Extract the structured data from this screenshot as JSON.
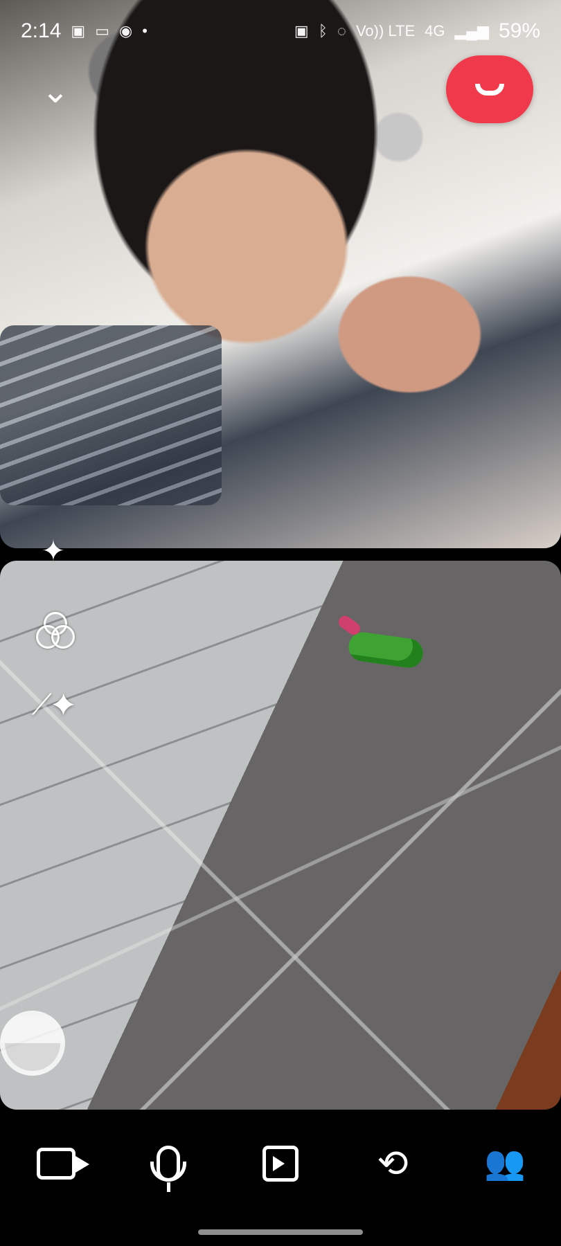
{
  "status_bar": {
    "time": "2:14",
    "left_icons": [
      "image-icon",
      "video-icon",
      "messenger-icon",
      "dot-icon"
    ],
    "right_icons": [
      "lock-icon",
      "bluetooth-icon",
      "mute-icon",
      "volte-icon",
      "4g-icon",
      "signal-icon"
    ],
    "volte_text": "Vo)) LTE",
    "network_text": "4G",
    "battery_text": "59%"
  },
  "call": {
    "collapse_glyph": "⌄",
    "end_call_color": "#f03a4b",
    "left_tools": [
      {
        "name": "sparkles-icon",
        "glyph": "✦"
      },
      {
        "name": "filters-icon"
      },
      {
        "name": "magic-wand-icon",
        "glyph": "⟋✦"
      }
    ]
  },
  "controls": [
    {
      "name": "video-camera-icon"
    },
    {
      "name": "microphone-icon"
    },
    {
      "name": "share-media-icon"
    },
    {
      "name": "switch-camera-icon",
      "glyph": "⟲"
    },
    {
      "name": "participants-icon",
      "glyph": "👥"
    }
  ]
}
